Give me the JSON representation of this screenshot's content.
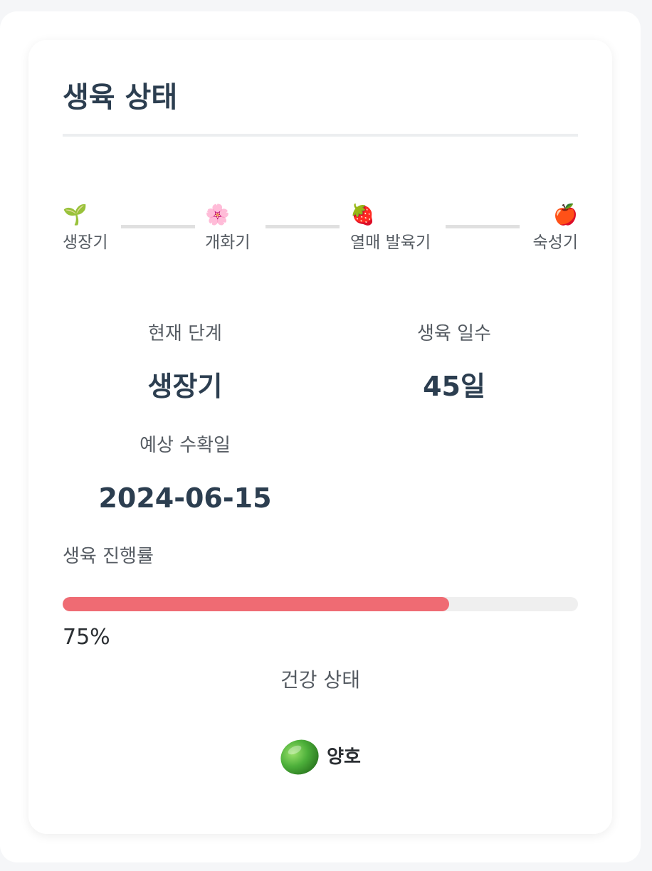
{
  "card": {
    "title": "생육 상태"
  },
  "stages": [
    {
      "icon": "🌱",
      "icon_name": "seedling-icon",
      "label": "생장기"
    },
    {
      "icon": "🌸",
      "icon_name": "cherry-blossom-icon",
      "label": "개화기"
    },
    {
      "icon": "🍓",
      "icon_name": "strawberry-icon",
      "label": "열매 발육기"
    },
    {
      "icon": "🍎",
      "icon_name": "apple-icon",
      "label": "숙성기"
    }
  ],
  "stats": {
    "current_stage": {
      "label": "현재 단계",
      "value": "생장기"
    },
    "growth_days": {
      "label": "생육 일수",
      "value": "45일"
    },
    "expected_harvest": {
      "label": "예상 수확일",
      "value": "2024-06-15"
    }
  },
  "progress": {
    "label": "생육 진행률",
    "value": 0.75,
    "text": "75%",
    "fill_color": "#ef6b73",
    "track_color": "#efefef"
  },
  "health": {
    "label": "건강 상태",
    "status": "양호",
    "indicator_color": "#4caf3a",
    "icon_name": "green-circle-icon"
  }
}
